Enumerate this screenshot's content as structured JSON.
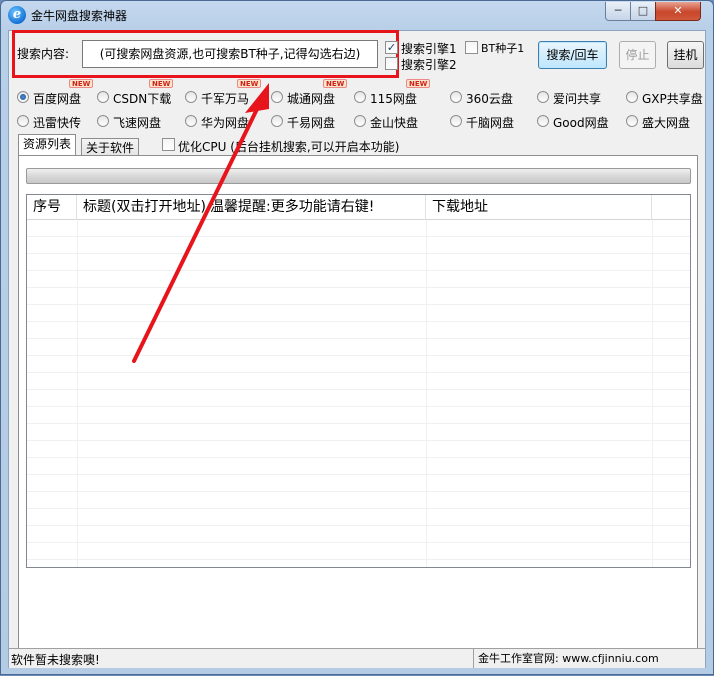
{
  "window": {
    "title": "金牛网盘搜索神器",
    "controls": {
      "minimize": "─",
      "maximize": "□",
      "close": "✕"
    }
  },
  "search": {
    "label": "搜索内容:",
    "placeholder": "(可搜索网盘资源,也可搜索BT种子,记得勾选右边)",
    "engine1_label": "搜索引擎1",
    "engine1_checked": true,
    "engine2_label": "搜索引擎2",
    "engine2_checked": false,
    "bt_label": "BT种子1",
    "bt_checked": false,
    "search_button": "搜索/回车",
    "stop_button": "停止",
    "hangup_button": "挂机"
  },
  "sources": [
    {
      "label": "百度网盘",
      "selected": true,
      "badge": "NEW"
    },
    {
      "label": "CSDN下载",
      "selected": false,
      "badge": "NEW"
    },
    {
      "label": "千军万马",
      "selected": false,
      "badge": "NEW"
    },
    {
      "label": "城通网盘",
      "selected": false,
      "badge": "NEW"
    },
    {
      "label": "115网盘",
      "selected": false,
      "badge": "NEW"
    },
    {
      "label": "360云盘",
      "selected": false,
      "badge": ""
    },
    {
      "label": "爱问共享",
      "selected": false,
      "badge": ""
    },
    {
      "label": "GXP共享盘",
      "selected": false,
      "badge": ""
    },
    {
      "label": "迅雷快传",
      "selected": false,
      "badge": ""
    },
    {
      "label": "飞速网盘",
      "selected": false,
      "badge": ""
    },
    {
      "label": "华为网盘",
      "selected": false,
      "badge": ""
    },
    {
      "label": "千易网盘",
      "selected": false,
      "badge": ""
    },
    {
      "label": "金山快盘",
      "selected": false,
      "badge": ""
    },
    {
      "label": "千脑网盘",
      "selected": false,
      "badge": ""
    },
    {
      "label": "Good网盘",
      "selected": false,
      "badge": ""
    },
    {
      "label": "盛大网盘",
      "selected": false,
      "badge": ""
    }
  ],
  "tabs": [
    {
      "label": "资源列表",
      "active": true
    },
    {
      "label": "关于软件",
      "active": false
    }
  ],
  "options": {
    "optimize_cpu_label": "优化CPU (后台挂机搜索,可以开启本功能)",
    "optimize_cpu_checked": false
  },
  "table": {
    "columns": [
      "序号",
      "标题(双击打开地址)",
      "温馨提醒:更多功能请右键!",
      "下载地址"
    ]
  },
  "status": {
    "left": "软件暂未搜索噢!",
    "right": "金牛工作室官网: www.cfjinniu.com"
  },
  "colors": {
    "highlight": "#e8141c",
    "arrow": "#e8141c",
    "badge_text": "#d0201c"
  },
  "icons": {
    "app": "ie-style-e-icon"
  }
}
